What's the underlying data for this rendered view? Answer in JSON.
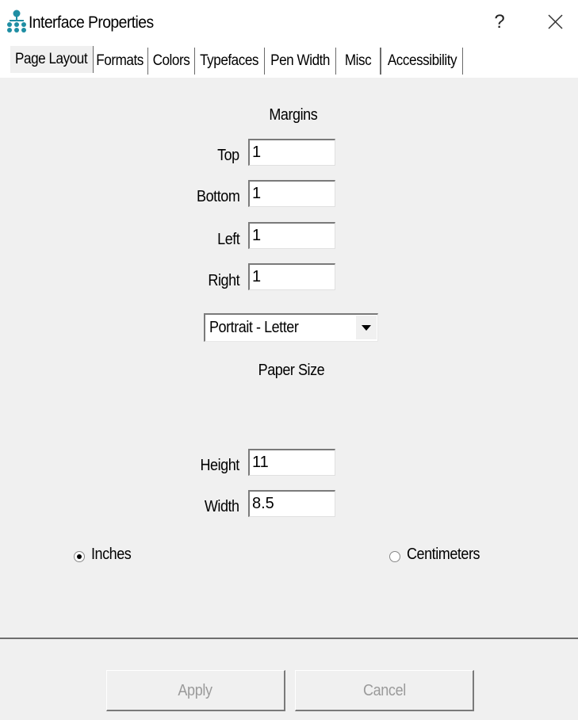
{
  "window": {
    "title": "Interface Properties",
    "help_glyph": "?",
    "close_icon": "close-icon",
    "app_icon": "hierarchy-icon"
  },
  "tabs": [
    {
      "label": "Page Layout",
      "active": true
    },
    {
      "label": "Formats",
      "active": false
    },
    {
      "label": "Colors",
      "active": false
    },
    {
      "label": "Typefaces",
      "active": false
    },
    {
      "label": "Pen Width",
      "active": false
    },
    {
      "label": "Misc",
      "active": false
    },
    {
      "label": "Accessibility",
      "active": false
    }
  ],
  "margins": {
    "heading": "Margins",
    "top_label": "Top",
    "top_value": "1",
    "bottom_label": "Bottom",
    "bottom_value": "1",
    "left_label": "Left",
    "left_value": "1",
    "right_label": "Right",
    "right_value": "1"
  },
  "paper": {
    "heading": "Paper Size",
    "size_selected": "Portrait - Letter",
    "height_label": "Height",
    "height_value": "11",
    "width_label": "Width",
    "width_value": "8.5"
  },
  "units": {
    "inches_label": "Inches",
    "inches_selected": true,
    "centimeters_label": "Centimeters",
    "centimeters_selected": false
  },
  "buttons": {
    "apply_label": "Apply",
    "cancel_label": "Cancel"
  },
  "colors": {
    "panel": "#f0f0f0",
    "icon_accent": "#1f8ea3",
    "disabled_text": "#9a9a9a"
  }
}
